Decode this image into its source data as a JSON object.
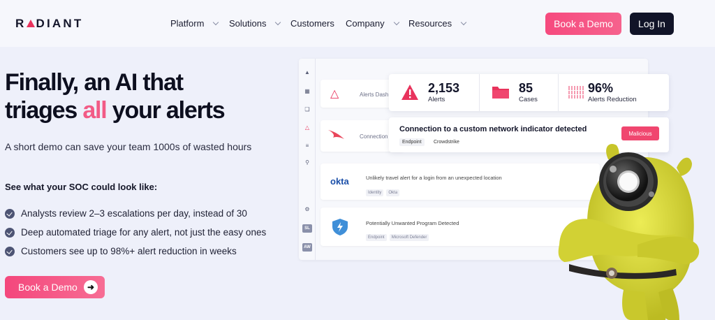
{
  "nav": {
    "logo": "RADIANT",
    "menu": [
      {
        "label": "Platform",
        "has_dropdown": true
      },
      {
        "label": "Solutions",
        "has_dropdown": true
      },
      {
        "label": "Customers",
        "has_dropdown": false
      },
      {
        "label": "Company",
        "has_dropdown": true
      },
      {
        "label": "Resources",
        "has_dropdown": true
      }
    ],
    "book_demo": "Book a Demo",
    "login": "Log In"
  },
  "hero": {
    "title_line1": "Finally, an AI that",
    "title_line2_pre": "triages ",
    "title_line2_accent": "all",
    "title_line2_post": " your alerts",
    "subtitle": "A short demo can save your team 1000s of wasted hours",
    "see_title": "See what your SOC could look like:",
    "bullets": [
      "Analysts review 2–3 escalations per day, instead of 30",
      "Deep automated triage for any alert, not just the easy ones",
      "Customers see up to 98%+ alert reduction in weeks"
    ],
    "cta": "Book a Demo"
  },
  "dashboard": {
    "sidebar_badges": [
      "SL",
      "AW"
    ],
    "rows": [
      {
        "label": "Alerts Dash",
        "icon": "warning-icon"
      },
      {
        "label": "Connection",
        "icon": "crowdstrike-falcon-icon"
      },
      {
        "logo": "okta",
        "title": "Unlikely travel alert for a login from an unexpected location",
        "tags": [
          "Identity",
          "Okta"
        ]
      },
      {
        "title": "Potentially Unwanted Program Detected",
        "tags": [
          "Endpoint",
          "Microsoft Defender"
        ]
      }
    ],
    "stats": [
      {
        "value": "2,153",
        "label": "Alerts",
        "icon": "warning-triangle-icon"
      },
      {
        "value": "85",
        "label": "Cases",
        "icon": "folder-icon"
      },
      {
        "value": "96%",
        "label": "Alerts Reduction",
        "icon": "grid-bars-icon"
      }
    ],
    "alert_card": {
      "title": "Connection to a custom network indicator detected",
      "tag1": "Endpoint",
      "tag2": "Crowdstrike",
      "status": "Malicious"
    }
  },
  "colors": {
    "accent_pink": "#f25b86",
    "dark": "#111428",
    "background": "#eef0fa",
    "mascot_yellow": "#d9d83a"
  }
}
